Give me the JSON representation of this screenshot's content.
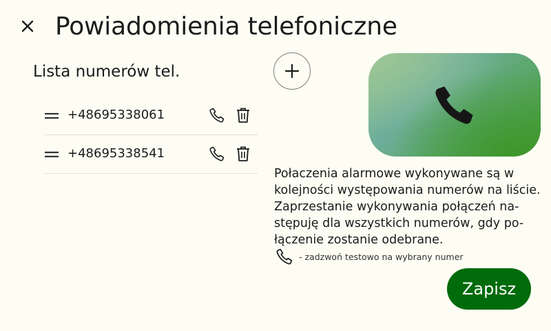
{
  "header": {
    "title": "Powiadomienia telefoniczne",
    "close_icon": "close-icon"
  },
  "list": {
    "title": "Lista numerów tel.",
    "items": [
      {
        "number": "+48695338061",
        "handle_icon": "drag-handle-icon",
        "call_icon": "phone-icon",
        "delete_icon": "trash-icon"
      },
      {
        "number": "+48695338541",
        "handle_icon": "drag-handle-icon",
        "call_icon": "phone-icon",
        "delete_icon": "trash-icon"
      }
    ],
    "add_icon": "plus-icon"
  },
  "hero": {
    "icon": "phone-icon"
  },
  "info": {
    "text": "Połaczenia alarmowe wykonywane są w\nkolejności występowania numerów na liście.\nZaprzestanie wykonywania połączeń na-\nstępuję dla wszystkich numerów, gdy po-\nłączenie zostanie odebrane.",
    "legend_icon": "phone-icon",
    "legend_text": "- zadzwoń testowo na wybrany numer"
  },
  "actions": {
    "save_label": "Zapisz"
  },
  "colors": {
    "background": "#fdfdf3",
    "primary": "#006b0a",
    "text": "#1b1b1b"
  }
}
